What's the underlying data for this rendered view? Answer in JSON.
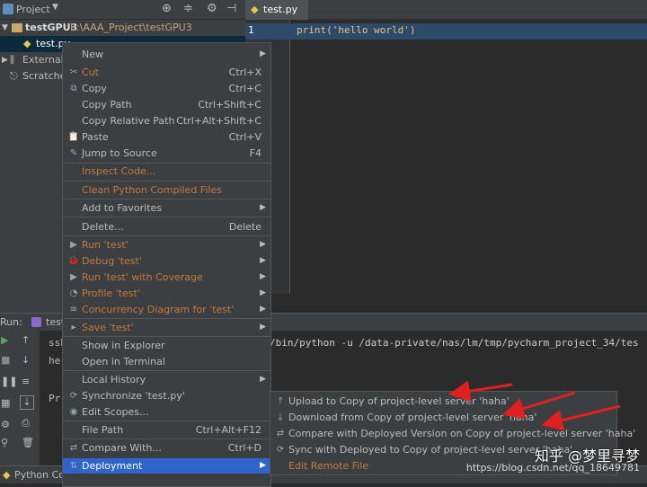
{
  "project": {
    "header_label": "Project",
    "root_name": "testGPU3",
    "root_path": "E:\\AAA_Project\\testGPU3",
    "file": "test.py",
    "external": "External L",
    "scratches": "Scratches"
  },
  "editor": {
    "tab": "test.py",
    "line_number": "1",
    "code_line": "print('hello world')"
  },
  "run": {
    "header_label": "Run:",
    "tab_label": "test",
    "console_lines": [
      "ssh",
      "he",
      "Pr"
    ],
    "command": "/bin/python -u /data-private/nas/lm/tmp/pycharm_project_34/tes"
  },
  "status": {
    "python_console": "Python Con"
  },
  "context_menu": {
    "items": [
      {
        "label": "New",
        "icon": "",
        "shortcut": "",
        "submenu": true,
        "disabled": false
      },
      {
        "label": "Cut",
        "icon": "✂",
        "shortcut": "Ctrl+X",
        "submenu": false,
        "disabled": true
      },
      {
        "label": "Copy",
        "icon": "⧉",
        "shortcut": "Ctrl+C",
        "submenu": false,
        "disabled": false
      },
      {
        "label": "Copy Path",
        "icon": "",
        "shortcut": "Ctrl+Shift+C",
        "submenu": false,
        "disabled": false
      },
      {
        "label": "Copy Relative Path",
        "icon": "",
        "shortcut": "Ctrl+Alt+Shift+C",
        "submenu": false,
        "disabled": false
      },
      {
        "label": "Paste",
        "icon": "📋",
        "shortcut": "Ctrl+V",
        "submenu": false,
        "disabled": false
      },
      {
        "label": "Jump to Source",
        "icon": "✎",
        "shortcut": "F4",
        "submenu": false,
        "disabled": false
      },
      {
        "label": "Inspect Code...",
        "icon": "",
        "shortcut": "",
        "submenu": false,
        "disabled": true
      },
      {
        "label": "Clean Python Compiled Files",
        "icon": "",
        "shortcut": "",
        "submenu": false,
        "disabled": true
      },
      {
        "label": "Add to Favorites",
        "icon": "",
        "shortcut": "",
        "submenu": true,
        "disabled": false
      },
      {
        "label": "Delete...",
        "icon": "",
        "shortcut": "Delete",
        "submenu": false,
        "disabled": false
      },
      {
        "label": "Run 'test'",
        "icon": "▶",
        "shortcut": "",
        "submenu": true,
        "disabled": true
      },
      {
        "label": "Debug 'test'",
        "icon": "🐞",
        "shortcut": "",
        "submenu": true,
        "disabled": true
      },
      {
        "label": "Run 'test' with Coverage",
        "icon": "▶",
        "shortcut": "",
        "submenu": true,
        "disabled": true
      },
      {
        "label": "Profile 'test'",
        "icon": "◔",
        "shortcut": "",
        "submenu": true,
        "disabled": true
      },
      {
        "label": "Concurrency Diagram for 'test'",
        "icon": "≡",
        "shortcut": "",
        "submenu": true,
        "disabled": true
      },
      {
        "label": "Save 'test'",
        "icon": "▸",
        "shortcut": "",
        "submenu": true,
        "disabled": true
      },
      {
        "label": "Show in Explorer",
        "icon": "",
        "shortcut": "",
        "submenu": false,
        "disabled": false
      },
      {
        "label": "Open in Terminal",
        "icon": "",
        "shortcut": "",
        "submenu": false,
        "disabled": false
      },
      {
        "label": "Local History",
        "icon": "",
        "shortcut": "",
        "submenu": true,
        "disabled": false
      },
      {
        "label": "Synchronize 'test.py'",
        "icon": "⟳",
        "shortcut": "",
        "submenu": false,
        "disabled": false
      },
      {
        "label": "Edit Scopes...",
        "icon": "◉",
        "shortcut": "",
        "submenu": false,
        "disabled": false
      },
      {
        "label": "File Path",
        "icon": "",
        "shortcut": "Ctrl+Alt+F12",
        "submenu": false,
        "disabled": false
      },
      {
        "label": "Compare With...",
        "icon": "⇄",
        "shortcut": "Ctrl+D",
        "submenu": false,
        "disabled": false
      },
      {
        "label": "Deployment",
        "icon": "⇅",
        "shortcut": "",
        "submenu": true,
        "disabled": false
      }
    ]
  },
  "deployment_submenu": {
    "items": [
      {
        "label": "Upload to Copy of project-level server 'haha'",
        "icon": "⤒",
        "disabled": false
      },
      {
        "label": "Download from Copy of project-level server 'haha'",
        "icon": "⤓",
        "disabled": false
      },
      {
        "label": "Compare with Deployed Version on Copy of project-level server 'haha'",
        "icon": "⇄",
        "disabled": false
      },
      {
        "label": "Sync with Deployed to Copy of project-level server 'haha'...",
        "icon": "⟳",
        "disabled": false
      },
      {
        "label": "Edit Remote File",
        "icon": "",
        "disabled": true
      }
    ]
  },
  "watermark": {
    "text": "知乎 @梦里寻梦",
    "url": "https://blog.csdn.net/qq_18649781"
  },
  "colors": {
    "highlight": "#2f65ca",
    "disabled_text": "#c07a3f",
    "annotation_arrow": "#e02020"
  }
}
